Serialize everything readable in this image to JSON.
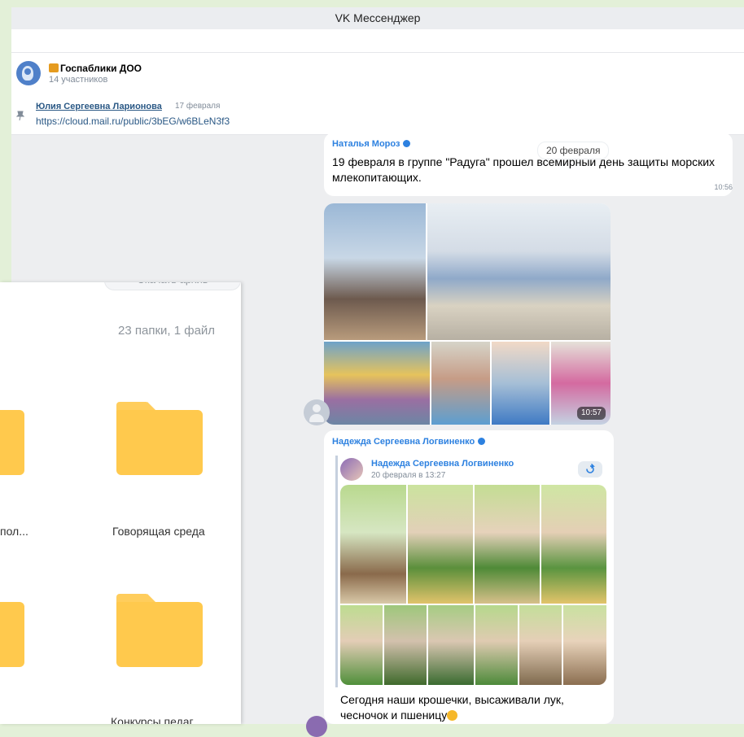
{
  "window": {
    "title": "VK Мессенджер"
  },
  "chat": {
    "title": "Госпаблики ДОО",
    "members": "14 участников"
  },
  "pinned": {
    "author": "Юлия Сергеевна Ларионова",
    "date": "17 февраля",
    "link": "https://cloud.mail.ru/public/3bEG/w6BLeN3f3"
  },
  "date_chip": "20 февраля",
  "messages": [
    {
      "sender": "Наталья Мороз",
      "text": "19 февраля в группе \"Радуга\" прошел всемирный день защиты морских млекопитающих.",
      "time": "10:56",
      "photos_time": "10:57"
    },
    {
      "sender": "Надежда Сергеевна Логвиненко",
      "forwarded": {
        "author": "Надежда Сергеевна Логвиненко",
        "date": "20 февраля в 13:27"
      },
      "text": "Сегодня наши крошечки, высаживали лук, чесночок и пшеницу"
    }
  ],
  "cloud": {
    "top_button": "Скачать архив",
    "count": "23 папки, 1 файл",
    "folders": [
      {
        "label": "пол..."
      },
      {
        "label": "Говорящая среда"
      },
      {
        "label": ""
      },
      {
        "label": "Конкурсы педаг"
      }
    ]
  },
  "colors": {
    "accent": "#2d81e0",
    "folder": "#ffc94d",
    "background": "#e3f0d8"
  }
}
